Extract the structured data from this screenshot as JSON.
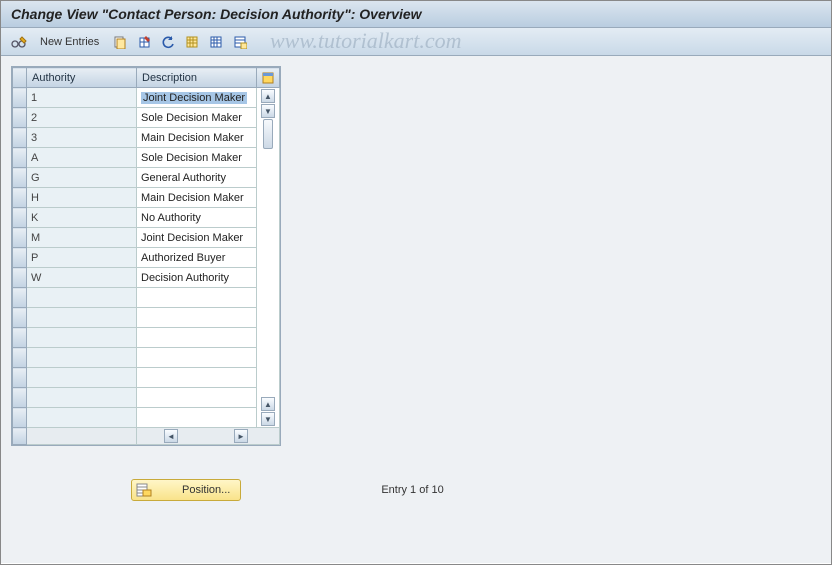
{
  "title": "Change View \"Contact Person: Decision Authority\": Overview",
  "watermark": "www.tutorialkart.com",
  "toolbar": {
    "new_entries_label": "New Entries"
  },
  "columns": {
    "authority": "Authority",
    "description": "Description"
  },
  "rows": [
    {
      "authority": "1",
      "description": "Joint Decision Maker",
      "selected": true
    },
    {
      "authority": "2",
      "description": "Sole Decision Maker",
      "selected": false
    },
    {
      "authority": "3",
      "description": "Main Decision Maker",
      "selected": false
    },
    {
      "authority": "A",
      "description": "Sole Decision Maker",
      "selected": false
    },
    {
      "authority": "G",
      "description": "General Authority",
      "selected": false
    },
    {
      "authority": "H",
      "description": "Main Decision Maker",
      "selected": false
    },
    {
      "authority": "K",
      "description": "No Authority",
      "selected": false
    },
    {
      "authority": "M",
      "description": "Joint Decision Maker",
      "selected": false
    },
    {
      "authority": "P",
      "description": "Authorized Buyer",
      "selected": false
    },
    {
      "authority": "W",
      "description": "Decision Authority",
      "selected": false
    }
  ],
  "empty_rows": 7,
  "position_button": "Position...",
  "entry_status": "Entry 1 of 10"
}
